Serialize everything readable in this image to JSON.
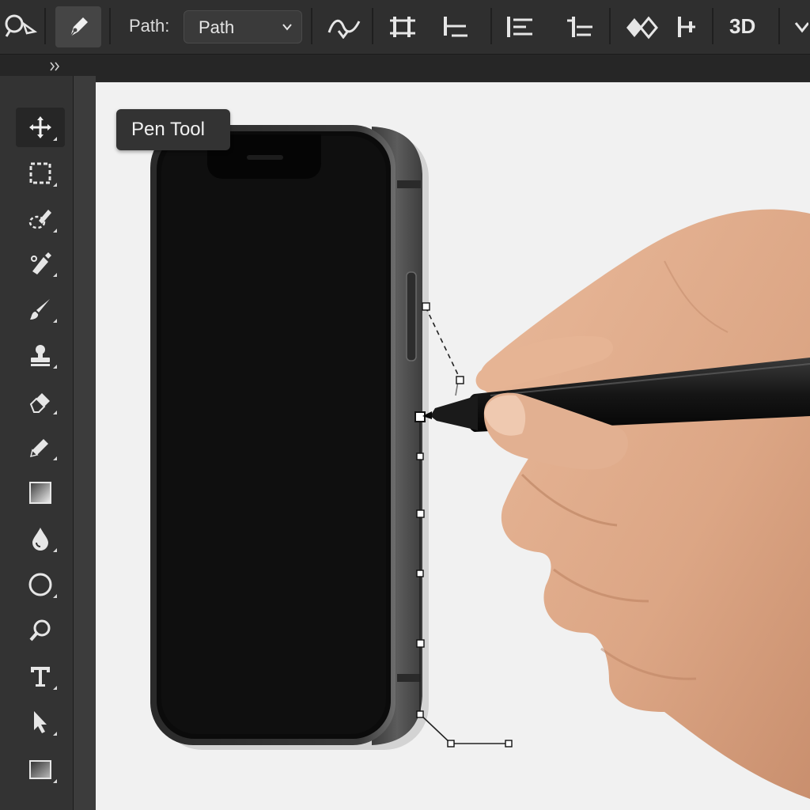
{
  "options_bar": {
    "path_label": "Path:",
    "path_mode": {
      "selected": "Path"
    },
    "three_d_label": "3D"
  },
  "toolbar": {
    "tools": [
      {
        "name": "move",
        "icon": "move-icon",
        "selected": true
      },
      {
        "name": "rectangular-marquee",
        "icon": "marquee-icon"
      },
      {
        "name": "quick-selection",
        "icon": "quick-selection-icon"
      },
      {
        "name": "healing-brush",
        "icon": "healing-brush-icon"
      },
      {
        "name": "brush",
        "icon": "brush-icon"
      },
      {
        "name": "clone-stamp",
        "icon": "stamp-icon"
      },
      {
        "name": "eraser",
        "icon": "eraser-icon"
      },
      {
        "name": "pencil",
        "icon": "pencil-icon"
      },
      {
        "name": "gradient",
        "icon": "gradient-icon"
      },
      {
        "name": "blur",
        "icon": "drop-icon"
      },
      {
        "name": "ellipse",
        "icon": "ellipse-icon"
      },
      {
        "name": "zoom",
        "icon": "zoom-icon"
      },
      {
        "name": "type",
        "icon": "type-icon"
      },
      {
        "name": "path-selection",
        "icon": "arrow-icon"
      },
      {
        "name": "rectangle",
        "icon": "rectangle-icon"
      }
    ]
  },
  "tooltip": {
    "text": "Pen Tool"
  },
  "colors": {
    "ui_dark": "#2f2f2f",
    "toolbar": "#333333",
    "canvas": "#f1f1f1",
    "phone_frame": "#4a4a4a",
    "screen": "#0c0c0c"
  }
}
